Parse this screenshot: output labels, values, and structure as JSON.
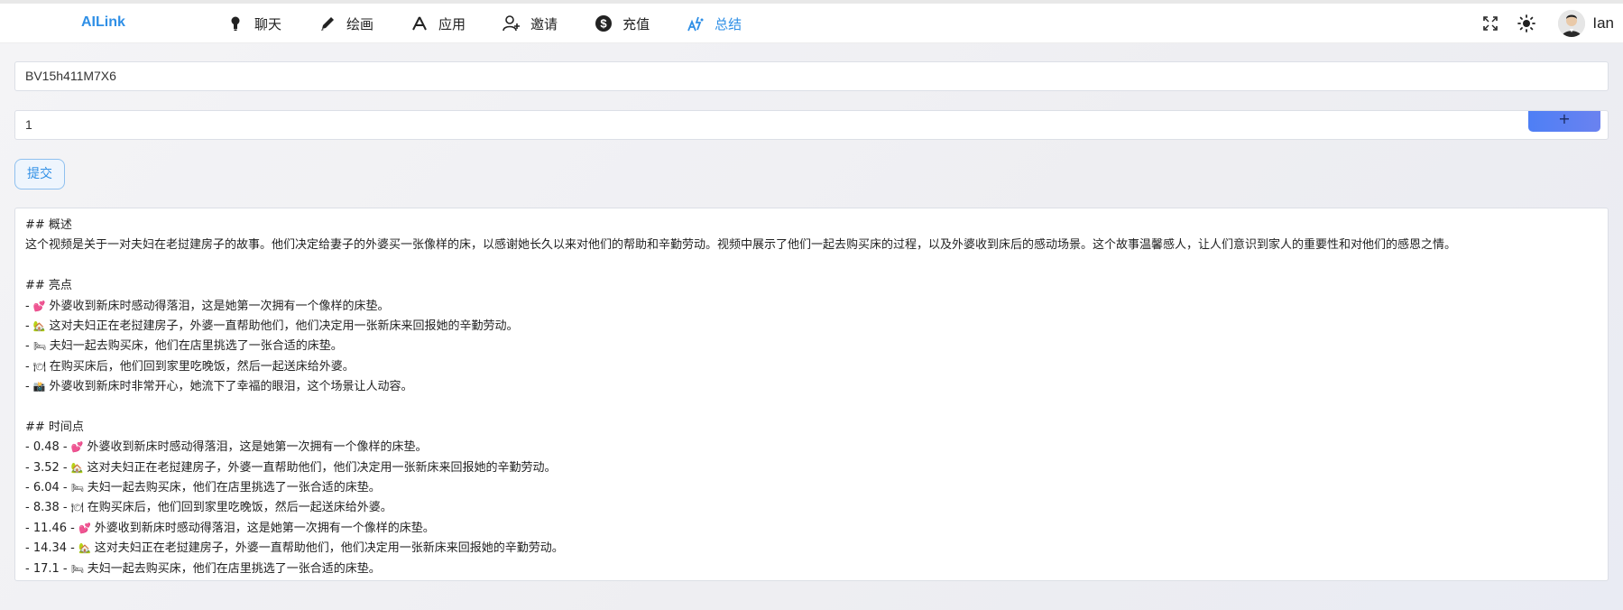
{
  "app": {
    "logo": "AILink"
  },
  "nav": [
    {
      "label": "聊天",
      "icon": "bulb-icon"
    },
    {
      "label": "绘画",
      "icon": "pencil-icon"
    },
    {
      "label": "应用",
      "icon": "app-icon"
    },
    {
      "label": "邀请",
      "icon": "invite-user-icon"
    },
    {
      "label": "充值",
      "icon": "dollar-icon"
    },
    {
      "label": "总结",
      "icon": "summary-icon",
      "active": true
    }
  ],
  "header_right": {
    "icons": [
      "fullscreen-icon",
      "theme-sun-icon"
    ],
    "username": "Ian"
  },
  "form": {
    "bv_value": "BV15h411M7X6",
    "number_value": "1",
    "plus_label": "+",
    "submit_label": "提交"
  },
  "colors": {
    "accent": "#2f8fe6",
    "button_gradient": "#5a80f2"
  },
  "result": {
    "overview_heading": "## 概述",
    "overview_text": "这个视频是关于一对夫妇在老挝建房子的故事。他们决定给妻子的外婆买一张像样的床，以感谢她长久以来对他们的帮助和辛勤劳动。视频中展示了他们一起去购买床的过程，以及外婆收到床后的感动场景。这个故事温馨感人，让人们意识到家人的重要性和对他们的感恩之情。",
    "highlights_heading": "## 亮点",
    "highlights": [
      {
        "prefix": "- ",
        "emoji": "💕",
        "text": "外婆收到新床时感动得落泪，这是她第一次拥有一个像样的床垫。"
      },
      {
        "prefix": "- ",
        "emoji": "🏡",
        "text": "这对夫妇正在老挝建房子，外婆一直帮助他们，他们决定用一张新床来回报她的辛勤劳动。"
      },
      {
        "prefix": "- ",
        "emoji": "🛏",
        "text": "夫妇一起去购买床，他们在店里挑选了一张合适的床垫。"
      },
      {
        "prefix": "- ",
        "emoji": "🍽",
        "text": "在购买床后，他们回到家里吃晚饭，然后一起送床给外婆。"
      },
      {
        "prefix": "- ",
        "emoji": "📸",
        "text": "外婆收到新床时非常开心，她流下了幸福的眼泪，这个场景让人动容。"
      }
    ],
    "timeline_heading": "## 时间点",
    "timeline": [
      {
        "prefix": "- 0.48 - ",
        "emoji": "💕",
        "text": "外婆收到新床时感动得落泪，这是她第一次拥有一个像样的床垫。"
      },
      {
        "prefix": "- 3.52 - ",
        "emoji": "🏡",
        "text": "这对夫妇正在老挝建房子，外婆一直帮助他们，他们决定用一张新床来回报她的辛勤劳动。"
      },
      {
        "prefix": "- 6.04 - ",
        "emoji": "🛏",
        "text": "夫妇一起去购买床，他们在店里挑选了一张合适的床垫。"
      },
      {
        "prefix": "- 8.38 - ",
        "emoji": "🍽",
        "text": "在购买床后，他们回到家里吃晚饭，然后一起送床给外婆。"
      },
      {
        "prefix": "- 11.46 - ",
        "emoji": "💕",
        "text": "外婆收到新床时感动得落泪，这是她第一次拥有一个像样的床垫。"
      },
      {
        "prefix": "- 14.34 - ",
        "emoji": "🏡",
        "text": "这对夫妇正在老挝建房子，外婆一直帮助他们，他们决定用一张新床来回报她的辛勤劳动。"
      },
      {
        "prefix": "- 17.1 - ",
        "emoji": "🛏",
        "text": "夫妇一起去购买床，他们在店里挑选了一张合适的床垫。"
      }
    ]
  }
}
